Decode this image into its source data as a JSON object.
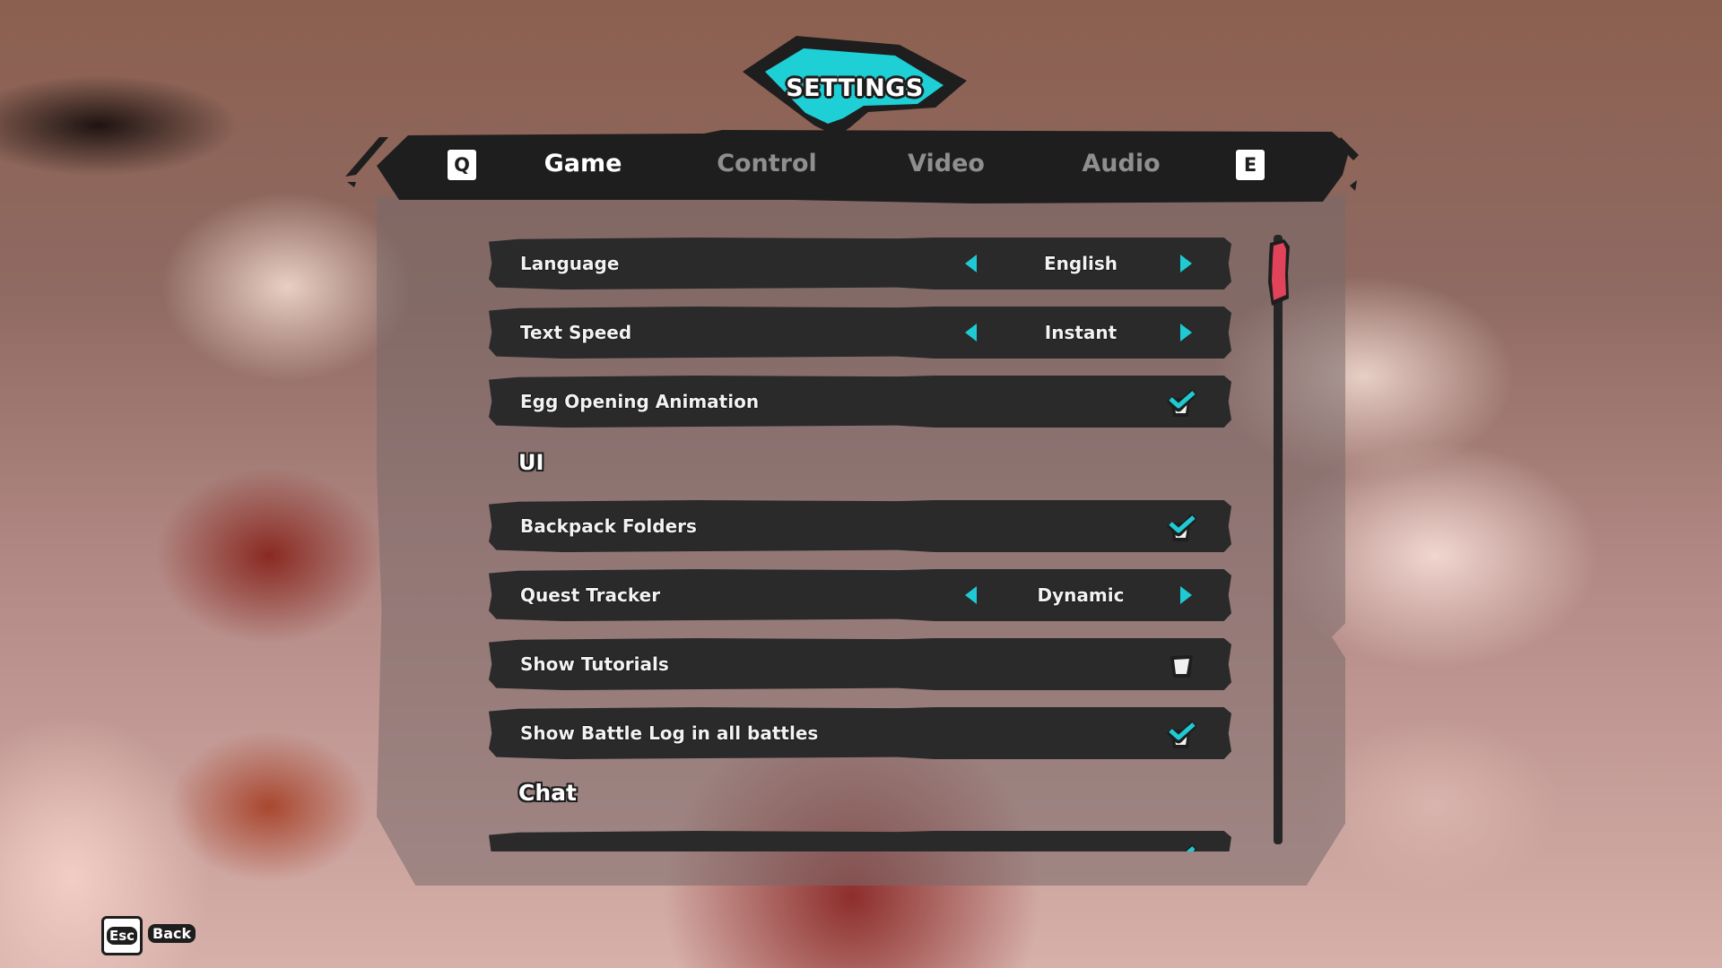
{
  "header": {
    "title": "SETTINGS"
  },
  "tabs": {
    "prev_key": "Q",
    "next_key": "E",
    "items": [
      {
        "label": "Game",
        "active": true
      },
      {
        "label": "Control",
        "active": false
      },
      {
        "label": "Video",
        "active": false
      },
      {
        "label": "Audio",
        "active": false
      }
    ]
  },
  "settings": {
    "rows": [
      {
        "label": "Language",
        "type": "selector",
        "value": "English"
      },
      {
        "label": "Text Speed",
        "type": "selector",
        "value": "Instant"
      },
      {
        "label": "Egg Opening Animation",
        "type": "checkbox",
        "checked": true
      }
    ],
    "sections": [
      {
        "title": "UI",
        "rows": [
          {
            "label": "Backpack Folders",
            "type": "checkbox",
            "checked": true
          },
          {
            "label": "Quest Tracker",
            "type": "selector",
            "value": "Dynamic"
          },
          {
            "label": "Show Tutorials",
            "type": "checkbox",
            "checked": false
          },
          {
            "label": "Show Battle Log in all battles",
            "type": "checkbox",
            "checked": true
          }
        ]
      },
      {
        "title": "Chat",
        "rows": [
          {
            "label": "",
            "type": "checkbox",
            "checked": true
          }
        ]
      }
    ]
  },
  "scrollbar": {
    "position_fraction": 0.0
  },
  "footer": {
    "esc_key": "Esc",
    "back_label": "Back"
  },
  "colors": {
    "accent_cyan": "#1fcad3",
    "scroll_thumb": "#e0435a",
    "row_bg": "#2a2a2a",
    "bar_bg": "#1e1e1e",
    "inactive_tab": "#8f8f8f"
  }
}
